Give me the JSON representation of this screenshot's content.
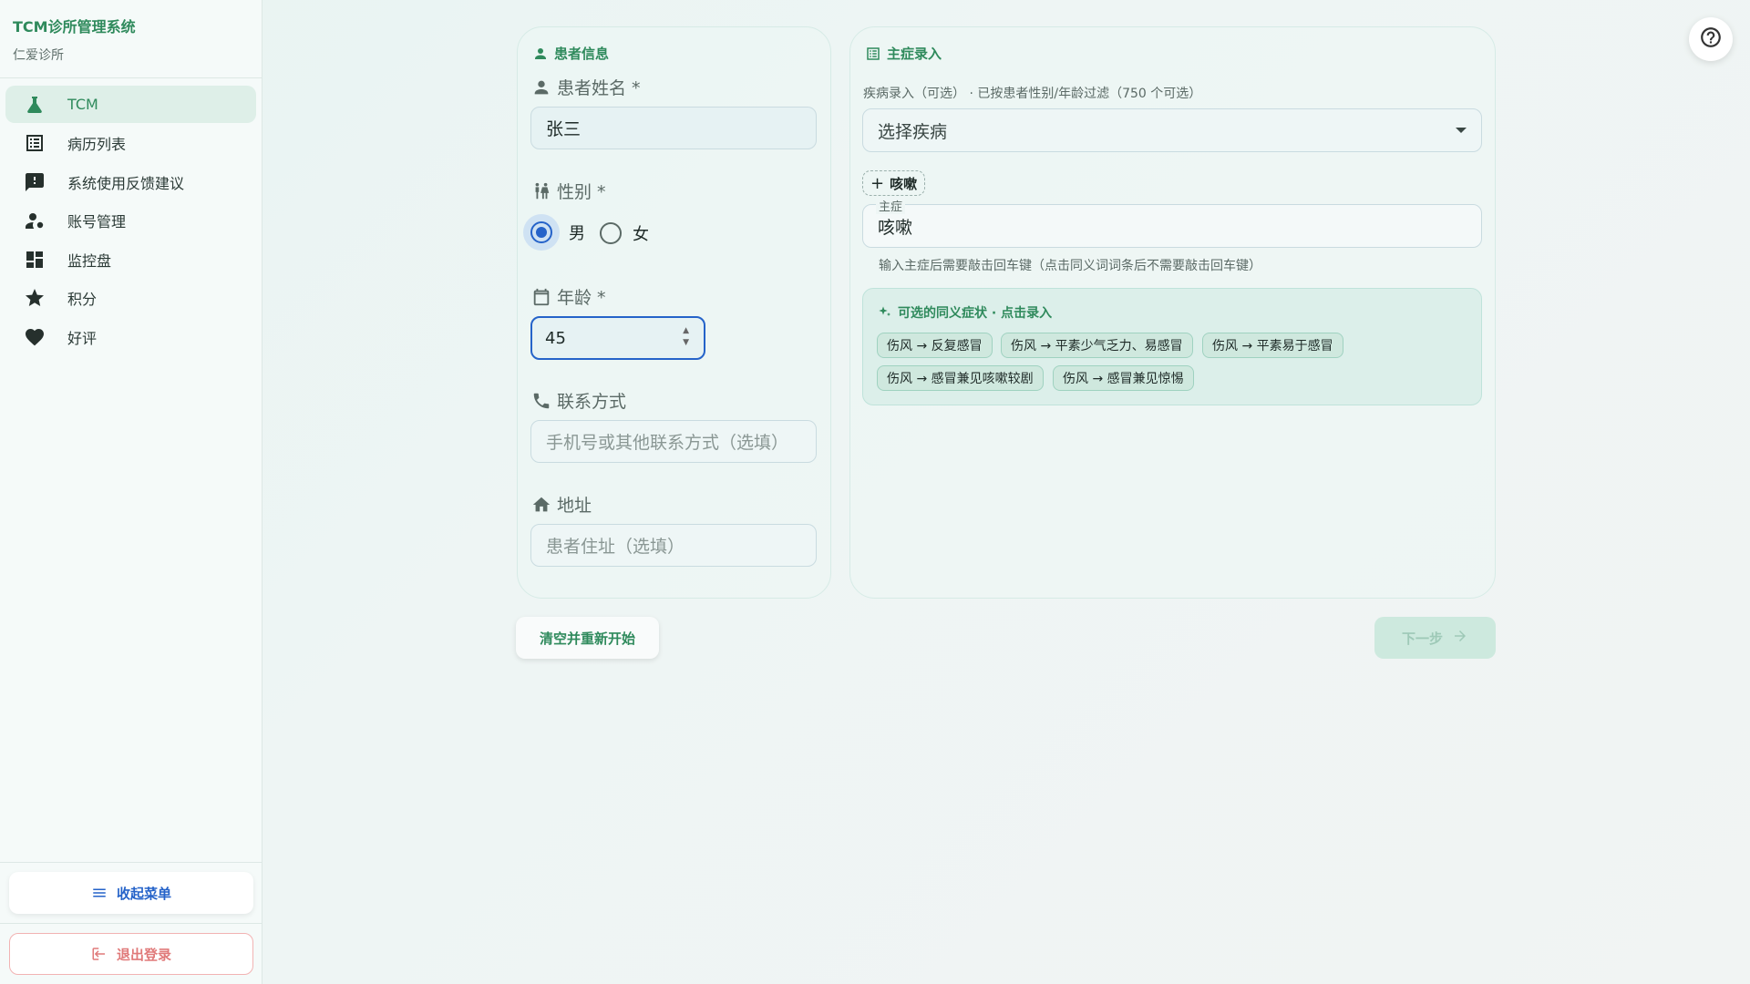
{
  "brand": {
    "title": "TCM诊所管理系统",
    "subtitle": "仁爱诊所"
  },
  "nav": {
    "items": [
      {
        "label": "TCM",
        "icon": "flask-icon",
        "active": true
      },
      {
        "label": "病历列表",
        "icon": "list-icon"
      },
      {
        "label": "系统使用反馈建议",
        "icon": "feedback-icon"
      },
      {
        "label": "账号管理",
        "icon": "manage-accounts-icon"
      },
      {
        "label": "监控盘",
        "icon": "dashboard-icon"
      },
      {
        "label": "积分",
        "icon": "star-icon"
      },
      {
        "label": "好评",
        "icon": "heart-icon"
      }
    ],
    "collapse_label": "收起菜单",
    "logout_label": "退出登录"
  },
  "patient": {
    "section_title": "患者信息",
    "name_label": "患者姓名 *",
    "name_value": "张三",
    "gender_label": "性别 *",
    "gender_options": [
      "男",
      "女"
    ],
    "gender_selected": "男",
    "age_label": "年龄 *",
    "age_value": "45",
    "contact_label": "联系方式",
    "contact_placeholder": "手机号或其他联系方式（选填）",
    "address_label": "地址",
    "address_placeholder": "患者住址（选填）"
  },
  "complaint": {
    "section_title": "主症录入",
    "disease_hint": "疾病录入（可选） · 已按患者性别/年龄过滤（750 个可选）",
    "disease_placeholder": "选择疾病",
    "added_chip": "咳嗽",
    "main_label": "主症",
    "main_value": "咳嗽",
    "main_helper": "输入主症后需要敲击回车键（点击同义词词条后不需要敲击回车键）",
    "synonyms_title": "可选的同义症状 · 点击录入",
    "synonyms": [
      "伤风 → 反复感冒",
      "伤风 → 平素少气乏力、易感冒",
      "伤风 → 平素易于感冒",
      "伤风 → 感冒兼见咳嗽较剧",
      "伤风 → 感冒兼见惊惕"
    ]
  },
  "actions": {
    "clear_label": "清空并重新开始",
    "next_label": "下一步"
  },
  "colors": {
    "primary_green": "#2f8a5c",
    "accent_blue": "#2563c9",
    "teal": "#1f9aa8",
    "logout_red": "#e07a7a"
  }
}
